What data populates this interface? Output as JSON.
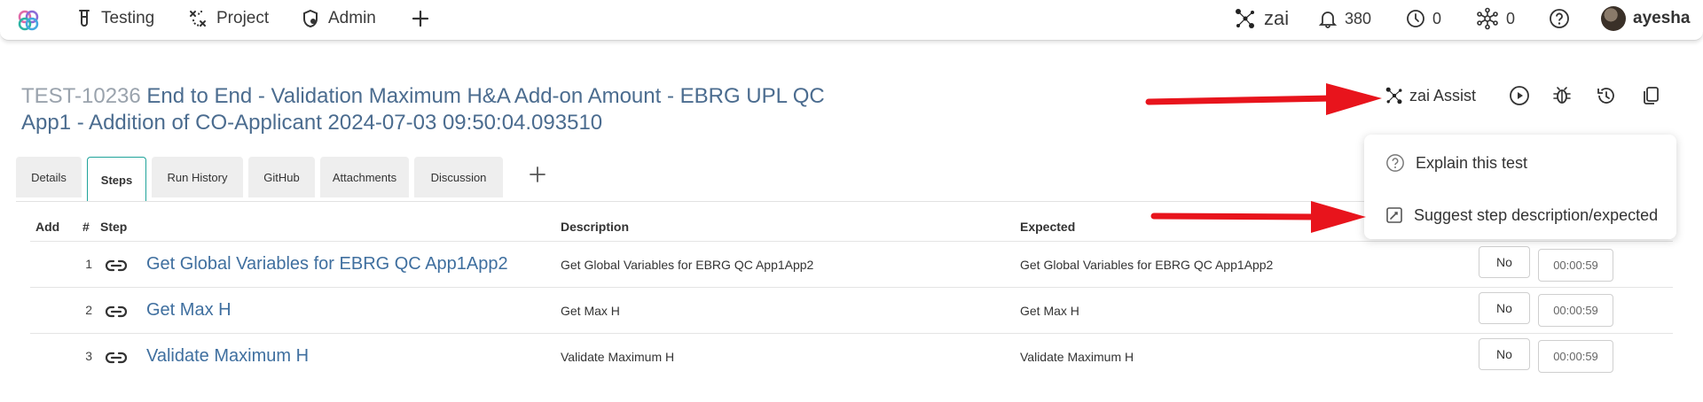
{
  "nav": {
    "items": [
      {
        "label": "Testing",
        "icon": "test-tube-icon"
      },
      {
        "label": "Project",
        "icon": "project-icon"
      },
      {
        "label": "Admin",
        "icon": "admin-shield-icon"
      }
    ],
    "add_icon": "plus-icon",
    "zai_label": "zai",
    "notifications_count": "380",
    "clock_count": "0",
    "network_count": "0",
    "username": "ayesha"
  },
  "test": {
    "id": "TEST-10236",
    "title": " End to End - Validation Maximum H&A Add-on Amount - EBRG UPL QC App1 - Addition of CO-Applicant 2024-07-03 09:50:04.093510"
  },
  "header_actions": {
    "zai_assist_label": "zai Assist"
  },
  "tabs": [
    {
      "label": "Details",
      "active": false
    },
    {
      "label": "Steps",
      "active": true
    },
    {
      "label": "Run History",
      "active": false
    },
    {
      "label": "GitHub",
      "active": false
    },
    {
      "label": "Attachments",
      "active": false
    },
    {
      "label": "Discussion",
      "active": false
    }
  ],
  "table": {
    "headers": {
      "add": "Add",
      "num": "#",
      "step": "Step",
      "description": "Description",
      "expected": "Expected"
    },
    "rows": [
      {
        "num": "1",
        "step": "Get Global Variables for EBRG QC App1App2",
        "description": "Get Global Variables for EBRG QC App1App2",
        "expected": "Get Global Variables for EBRG QC App1App2",
        "result": "No",
        "time": "00:00:59"
      },
      {
        "num": "2",
        "step": "Get Max H",
        "description": "Get Max H",
        "expected": "Get Max H",
        "result": "No",
        "time": "00:00:59"
      },
      {
        "num": "3",
        "step": "Validate Maximum H",
        "description": "Validate Maximum H",
        "expected": "Validate Maximum H",
        "result": "No",
        "time": "00:00:59"
      }
    ]
  },
  "dropdown": {
    "items": [
      {
        "label": "Explain this test",
        "icon": "question-circle-icon"
      },
      {
        "label": "Suggest step description/expected",
        "icon": "edit-square-icon"
      }
    ]
  },
  "colors": {
    "accent": "#1fa39a",
    "link": "#3f6f9f",
    "arrow": "#e8141c"
  }
}
